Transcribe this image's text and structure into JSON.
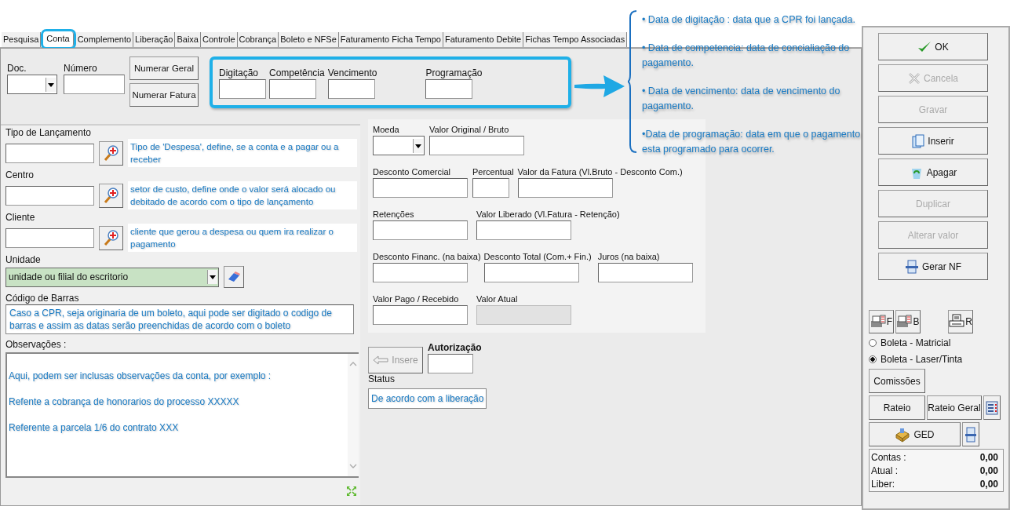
{
  "tabs": [
    {
      "label": "Pesquisa",
      "selected": false
    },
    {
      "label": "Conta",
      "selected": true
    },
    {
      "label": "Complemento",
      "selected": false
    },
    {
      "label": "Liberação",
      "selected": false
    },
    {
      "label": "Baixa",
      "selected": false
    },
    {
      "label": "Controle",
      "selected": false
    },
    {
      "label": "Cobrança",
      "selected": false
    },
    {
      "label": "Boleto e NFSe",
      "selected": false
    },
    {
      "label": "Faturamento Ficha Tempo",
      "selected": false
    },
    {
      "label": "Faturamento Debite",
      "selected": false
    },
    {
      "label": "Fichas Tempo Associadas",
      "selected": false
    }
  ],
  "doc": {
    "label": "Doc.",
    "number_label": "Número"
  },
  "number_buttons": [
    "Numerar Geral",
    "Numerar Fatura"
  ],
  "date_fields": [
    {
      "label": "Digitação"
    },
    {
      "label": "Competência"
    },
    {
      "label": "Vencimento"
    },
    {
      "label": "Programação"
    }
  ],
  "date_notes": [
    "•  Data de digitação : data que a CPR foi lançada.",
    "•  Data de competencia: data de concialiação do pagamento.",
    "• Data de vencimento: data de vencimento do pagamento.",
    "•Data de programação: data em que o pagamento esta programado para ocorrer."
  ],
  "lookups": [
    {
      "label": "Tipo de Lançamento",
      "hint": "Tipo de 'Despesa', define, se a conta e a pagar ou a receber"
    },
    {
      "label": "Centro",
      "hint": "setor de custo, define onde o valor será alocado ou debitado de acordo com o tipo de lançamento"
    },
    {
      "label": "Cliente",
      "hint": "cliente que gerou a despesa ou quem ira realizar o pagamento"
    }
  ],
  "unidade": {
    "label": "Unidade",
    "value": "unidade ou filial do escritorio"
  },
  "codigo_barras": {
    "label": "Código de Barras",
    "value": "Caso a CPR, seja originaria de um boleto, aqui pode ser digitado o codigo de barras e assim as datas serão preenchidas de acordo com o boleto"
  },
  "observacoes": {
    "label": "Observações :",
    "lines": [
      "Aqui, podem ser inclusas observações da conta, por exemplo :",
      "Refente a cobrança de honorarios do processo XXXXX",
      "Referente a parcela 1/6 do contrato XXX"
    ]
  },
  "money_rows": [
    {
      "fields": [
        {
          "label": "Moeda",
          "kind": "select"
        },
        {
          "label": "Valor Original / Bruto",
          "kind": "input"
        }
      ]
    },
    {
      "fields": [
        {
          "label": "Desconto Comercial",
          "kind": "input"
        },
        {
          "label": "Percentual",
          "kind": "input"
        },
        {
          "label": "Valor da Fatura (Vl.Bruto - Desconto Com.)",
          "kind": "input"
        }
      ]
    },
    {
      "fields": [
        {
          "label": "Retenções",
          "kind": "input"
        },
        {
          "label": "Valor Liberado (Vl.Fatura - Retenção)",
          "kind": "input"
        }
      ]
    },
    {
      "fields": [
        {
          "label": "Desconto Financ. (na baixa)",
          "kind": "input"
        },
        {
          "label": "Desconto Total (Com.+ Fin.)",
          "kind": "input"
        },
        {
          "label": "Juros (na baixa)",
          "kind": "input"
        }
      ]
    },
    {
      "fields": [
        {
          "label": "Valor Pago / Recebido",
          "kind": "input"
        },
        {
          "label": "Valor Atual",
          "kind": "readonly"
        }
      ]
    }
  ],
  "insere_button": {
    "label": "Insere",
    "disabled": true
  },
  "autorizacao": {
    "label": "Autorização"
  },
  "status": {
    "label": "Status",
    "value": "De acordo com a liberação"
  },
  "actions": [
    {
      "label": "OK",
      "kind": "check",
      "disabled": false
    },
    {
      "label": "Cancela",
      "kind": "cross",
      "disabled": true
    },
    {
      "label": "Gravar",
      "kind": "plain",
      "disabled": true
    },
    {
      "label": "Inserir",
      "kind": "copy",
      "disabled": false
    },
    {
      "label": "Apagar",
      "kind": "recycle",
      "disabled": false
    },
    {
      "label": "Duplicar",
      "kind": "plain",
      "disabled": true
    },
    {
      "label": "Alterar valor",
      "kind": "plain",
      "disabled": true
    },
    {
      "label": "Gerar NF",
      "kind": "document",
      "disabled": false
    }
  ],
  "print_buttons": [
    {
      "label": "F",
      "kind": "list"
    },
    {
      "label": "B",
      "kind": "list"
    },
    {
      "label": "R",
      "kind": "printer"
    }
  ],
  "boleta_options": [
    {
      "label": "Boleta - Matricial",
      "selected": false
    },
    {
      "label": "Boleta - Laser/Tinta",
      "selected": true
    }
  ],
  "extra_buttons": {
    "comissoes": "Comissões",
    "rateio": "Rateio",
    "rateio_geral": "Rateio Geral",
    "ged": "GED"
  },
  "totals": [
    {
      "label": "Contas :",
      "value": "0,00"
    },
    {
      "label": "Atual :",
      "value": "0,00"
    },
    {
      "label": "Liber:",
      "value": "0,00"
    }
  ]
}
